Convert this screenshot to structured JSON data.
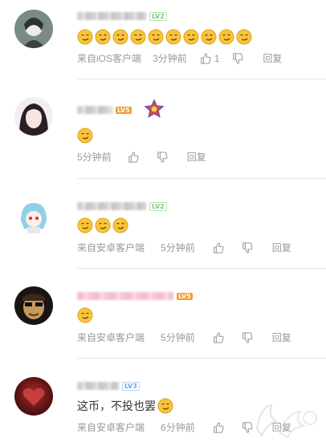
{
  "comments": [
    {
      "level": "LV2",
      "emoji_count": 10,
      "text": "",
      "source": "来自iOS客户端",
      "time": "3分钟前",
      "likes": "1",
      "reply": "回复"
    },
    {
      "level": "LV5",
      "emoji_count": 1,
      "text": "",
      "source": "",
      "time": "5分钟前",
      "likes": "",
      "reply": "回复"
    },
    {
      "level": "LV2",
      "emoji_count": 3,
      "text": "",
      "source": "来自安卓客户端",
      "time": "5分钟前",
      "likes": "",
      "reply": "回复"
    },
    {
      "level": "LV5",
      "emoji_count": 1,
      "text": "",
      "source": "来自安卓客户端",
      "time": "5分钟前",
      "likes": "",
      "reply": "回复"
    },
    {
      "level": "LV3",
      "emoji_count": 1,
      "text": "这币，不投也罢",
      "source": "来自安卓客户端",
      "time": "6分钟前",
      "likes": "",
      "reply": "回复"
    }
  ],
  "icons": {
    "emoji": "smirk-emoji-icon",
    "like": "thumbs-up-icon",
    "dislike": "thumbs-down-icon",
    "medal": "star-medal-icon"
  },
  "colors": {
    "lv_green": "#7fc97f",
    "lv_orange": "#f39a2d",
    "lv_blue": "#6aa9e6",
    "meta_text": "#999999"
  }
}
